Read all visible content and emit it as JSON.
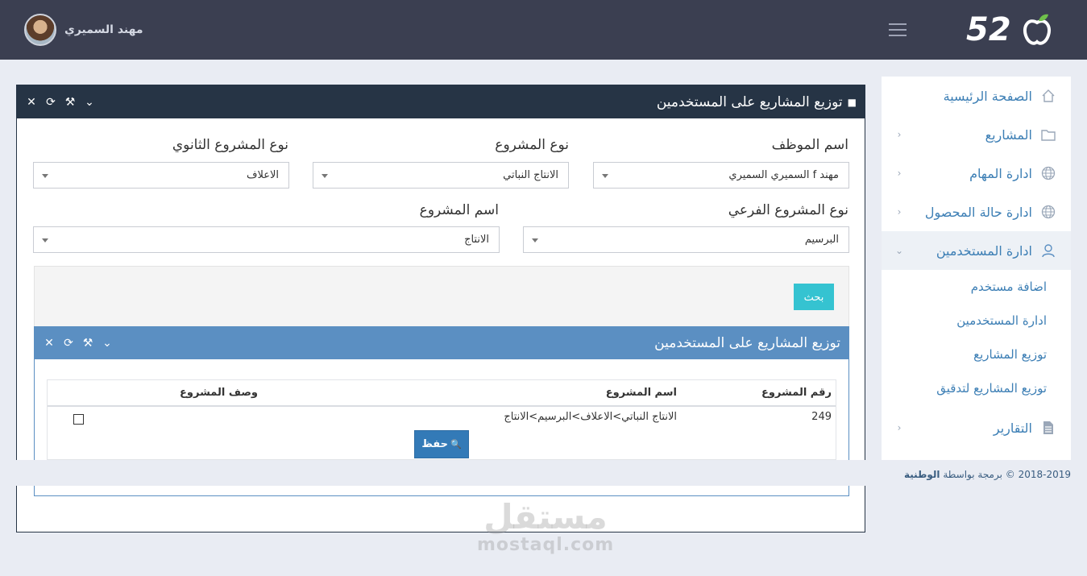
{
  "header": {
    "logo_text": "52",
    "user_name": "مهند السميري"
  },
  "sidebar": {
    "items": [
      {
        "label": "الصفحة الرئيسية",
        "icon": "home-icon"
      },
      {
        "label": "المشاريع",
        "icon": "folder-icon"
      },
      {
        "label": "ادارة المهام",
        "icon": "globe-icon"
      },
      {
        "label": "ادارة حالة المحصول",
        "icon": "globe-icon"
      },
      {
        "label": "ادارة المستخدمين",
        "icon": "user-icon"
      }
    ],
    "sub_items": [
      {
        "label": "اضافة مستخدم"
      },
      {
        "label": "ادارة المستخدمين"
      },
      {
        "label": "توزيع المشاريع"
      },
      {
        "label": "توزيع المشاريع لتدقيق"
      }
    ],
    "reports": {
      "label": "التقارير",
      "icon": "document-icon"
    }
  },
  "footer": {
    "copyright": "2018-2019 © برمجة بواسطة",
    "brand": "الوطنية"
  },
  "panel": {
    "title": "توزيع المشاريع على المستخدمين",
    "fields": {
      "employee": {
        "label": "اسم الموظف",
        "value": "مهند f السميري السميري"
      },
      "project_type": {
        "label": "نوع المشروع",
        "value": "الانتاج النباتي"
      },
      "secondary_type": {
        "label": "نوع المشروع الثانوي",
        "value": "الاعلاف"
      },
      "sub_type": {
        "label": "نوع المشروع الفرعي",
        "value": "البرسيم"
      },
      "project_name": {
        "label": "اسم المشروع",
        "value": "الانتاج"
      }
    },
    "search_label": "بحث"
  },
  "inner": {
    "title": "توزيع المشاريع على المستخدمين",
    "columns": [
      "رقم المشروع",
      "اسم المشروع",
      "وصف المشروع"
    ],
    "rows": [
      {
        "number": "249",
        "name": "الانتاج النباتي>الاعلاف>البرسيم>الانتاج",
        "checked": false
      }
    ],
    "save_label": "حفظ"
  },
  "watermark": {
    "arabic": "مستقل",
    "latin": "mostaql.com"
  }
}
